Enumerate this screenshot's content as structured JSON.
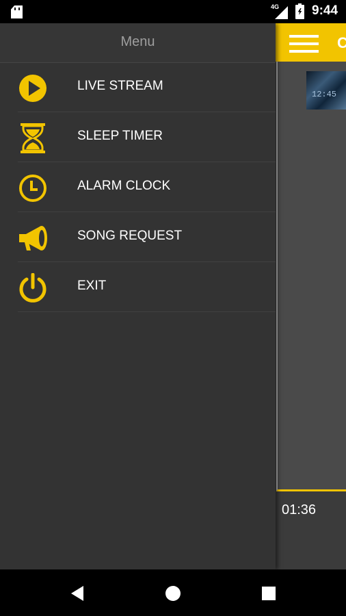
{
  "status_bar": {
    "time": "9:44",
    "network": "4G",
    "icons": [
      "sd-card-icon",
      "signal-icon",
      "battery-charging-icon"
    ]
  },
  "drawer": {
    "title": "Menu",
    "items": [
      {
        "label": "LIVE STREAM",
        "icon": "play-icon"
      },
      {
        "label": "SLEEP TIMER",
        "icon": "hourglass-icon"
      },
      {
        "label": "ALARM CLOCK",
        "icon": "clock-icon"
      },
      {
        "label": "SONG REQUEST",
        "icon": "megaphone-icon"
      },
      {
        "label": "EXIT",
        "icon": "power-icon"
      }
    ]
  },
  "background": {
    "app_bar_title": "C",
    "thumbnail_text": "12:45",
    "time_readout": "01:36"
  },
  "colors": {
    "accent": "#f2c400",
    "drawer_bg": "#333333",
    "text": "#ffffff"
  },
  "nav_bar": {
    "icons": [
      "back-icon",
      "home-icon",
      "recents-icon"
    ]
  }
}
